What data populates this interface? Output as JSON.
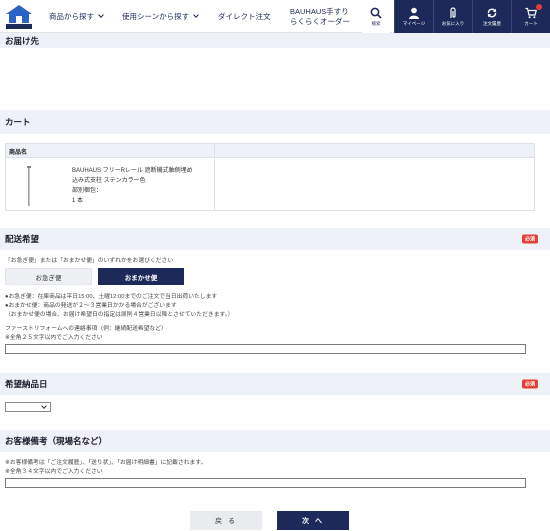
{
  "header": {
    "logo_text": "Bauhaus",
    "nav": [
      {
        "label": "商品から探す"
      },
      {
        "label": "使用シーンから探す"
      },
      {
        "label": "ダイレクト注文"
      }
    ],
    "nav_two_line": [
      "BAUHAUS手すり",
      "らくらくオーダー"
    ],
    "search_label": "検索",
    "icons": [
      {
        "label": "マイページ",
        "icon": "user-icon"
      },
      {
        "label": "お気に入り",
        "icon": "paperclip-icon"
      },
      {
        "label": "注文履歴",
        "icon": "history-icon"
      },
      {
        "label": "カート",
        "icon": "cart-icon"
      }
    ]
  },
  "sections": {
    "delivery_address": "お届け先",
    "cart": "カート",
    "shipping": "配送希望",
    "desired_date": "希望納品日",
    "remarks": "お客様備考（現場名など）"
  },
  "required_badge": "必須",
  "cart": {
    "col_header": "商品名",
    "item": {
      "name_line1": "BAUHAUS フリーRレール 遮断機式軸側埋め",
      "name_line2": "込み式支柱 ステンカラー色",
      "packaging": "部別梱包：",
      "quantity": "1 本"
    }
  },
  "shipping": {
    "prompt": "「お急ぎ便」または「おまかせ便」のいずれかをお選びください",
    "option_urgent": "お急ぎ便",
    "option_auto": "おまかせ便",
    "selected": "おまかせ便",
    "note1": "●お急ぎ便：在庫商品は平日15:00、土曜12:00までのご注文で当日出荷いたします",
    "note2": "●おまかせ便：商品の発送が２～３営業日かかる場合がございます",
    "note3": "（おまかせ便の場合、お届け希望日の指定は原則４営業日以降とさせていただきます。）",
    "contact_label": "ファーストリフォームへの連絡事項（例：継続配送希望など）",
    "contact_limit": "※全角２５文字以内でご入力ください",
    "contact_value": ""
  },
  "desired_date": {
    "selected": ""
  },
  "remarks": {
    "note1": "※お客様備考は「ご注文履歴」、「送り状」、「お届け明細書」に記載されます。",
    "note2": "※全角３４文字以内でご入力ください",
    "value": ""
  },
  "buttons": {
    "back": "戻 る",
    "next": "次 へ"
  },
  "colors": {
    "navy": "#1d2a59",
    "section_bg": "#eef2f8",
    "required_red": "#e54035"
  }
}
